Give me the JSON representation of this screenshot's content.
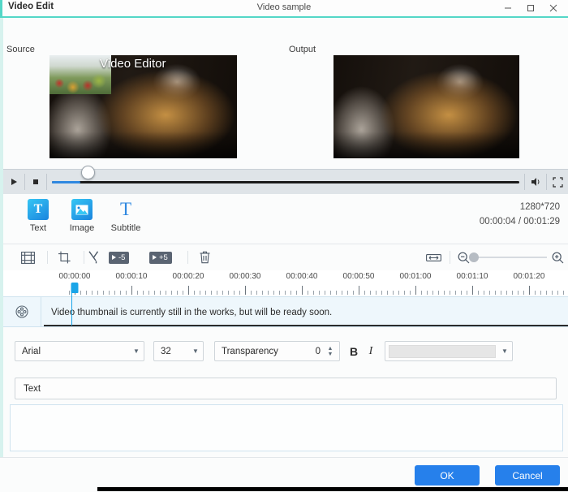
{
  "window": {
    "app_title": "Video Edit",
    "document_title": "Video sample",
    "minimize_label": "─",
    "maximize_label": "❐",
    "close_label": "✕",
    "accent_color": "#54d7c7"
  },
  "preview": {
    "source_label": "Source",
    "output_label": "Output",
    "overlay_text": "Video Editor"
  },
  "player": {
    "play_icon": "play-icon",
    "stop_icon": "stop-icon",
    "volume_icon": "volume-icon",
    "fullscreen_icon": "fullscreen-icon",
    "progress_percent": 6
  },
  "tools": [
    {
      "label": "Text",
      "icon": "text-icon",
      "glyph": "T"
    },
    {
      "label": "Image",
      "icon": "image-icon",
      "glyph": ""
    },
    {
      "label": "Subtitle",
      "icon": "subtitle-icon",
      "glyph": "T"
    }
  ],
  "media_info": {
    "resolution": "1280*720",
    "time": "00:00:04 / 00:01:29"
  },
  "edit_toolbar": [
    {
      "name": "filmstrip-icon",
      "label": ""
    },
    {
      "name": "crop-icon",
      "label": ""
    },
    {
      "name": "split-icon",
      "label": ""
    },
    {
      "name": "back-5-icon",
      "label": "-5"
    },
    {
      "name": "forward-5-icon",
      "label": "+5"
    },
    {
      "name": "delete-icon",
      "label": ""
    }
  ],
  "zoom_controls": {
    "fit_icon": "fit-width-icon",
    "zoom_out_icon": "zoom-out-icon",
    "zoom_in_icon": "zoom-in-icon",
    "slider_percent": 8
  },
  "timeline": {
    "labels": [
      "00:00:00",
      "00:00:10",
      "00:00:20",
      "00:00:30",
      "00:00:40",
      "00:00:50",
      "00:01:00",
      "00:01:10",
      "00:01:20"
    ],
    "playhead_label": "playhead"
  },
  "track": {
    "icon": "film-reel-icon",
    "message": "Video thumbnail is currently still in the works, but will be ready soon."
  },
  "text_properties": {
    "font_family": "Arial",
    "font_size": "32",
    "transparency_label": "Transparency",
    "transparency_value": "0",
    "bold_label": "B",
    "italic_label": "I",
    "color_swatch": "#e6e6e6",
    "text_value": "Text"
  },
  "footer": {
    "ok_label": "OK",
    "cancel_label": "Cancel",
    "button_color": "#2680eb"
  }
}
